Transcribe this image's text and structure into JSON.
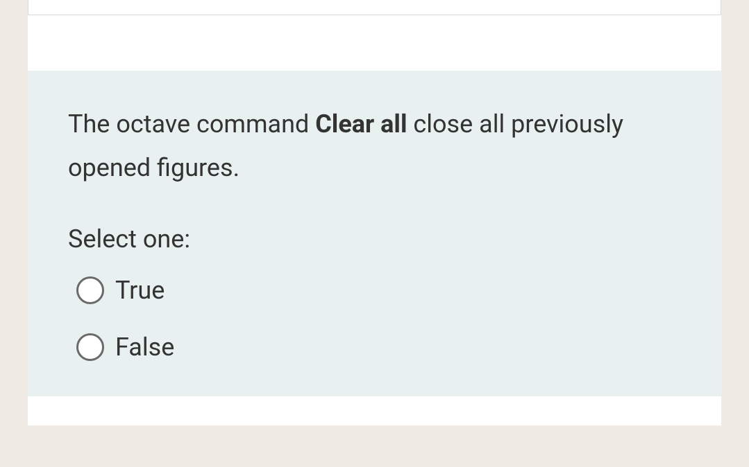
{
  "question": {
    "text_before": "The octave command ",
    "text_bold": "Clear all",
    "text_after": "  close all previously opened  figures."
  },
  "prompt": "Select one:",
  "options": [
    {
      "label": "True"
    },
    {
      "label": "False"
    }
  ]
}
